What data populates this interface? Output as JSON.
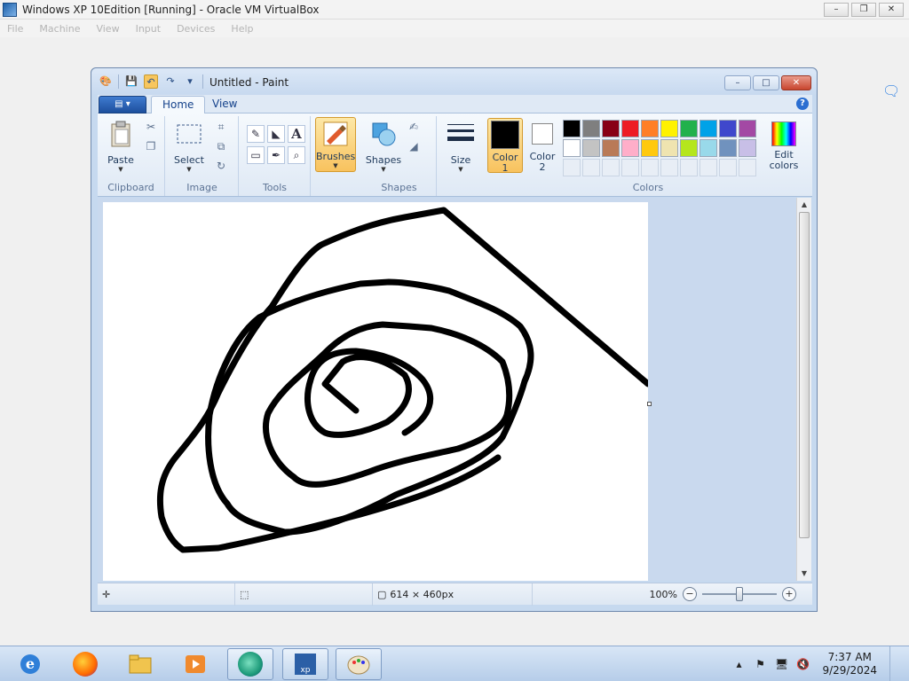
{
  "host": {
    "title": "Windows XP 10Edition [Running] - Oracle VM VirtualBox",
    "menu": [
      "File",
      "Machine",
      "View",
      "Input",
      "Devices",
      "Help"
    ],
    "win_buttons": [
      "–",
      "❐",
      "✕"
    ]
  },
  "paint": {
    "title": "Untitled - Paint",
    "tabs": {
      "file": "▤ ▾",
      "home": "Home",
      "view": "View"
    },
    "help": "?",
    "groups": {
      "clipboard": {
        "label": "Clipboard",
        "paste": "Paste"
      },
      "image": {
        "label": "Image",
        "select": "Select"
      },
      "tools": {
        "label": "Tools",
        "text": "A"
      },
      "brushes": {
        "label": "Brushes"
      },
      "shapes": {
        "label": "Shapes",
        "shapes": "Shapes"
      },
      "size": {
        "label": "Size"
      },
      "colors": {
        "label": "Colors",
        "color1": "Color\n1",
        "color1_a": "Color",
        "color1_b": "1",
        "color2_a": "Color",
        "color2_b": "2",
        "edit_a": "Edit",
        "edit_b": "colors",
        "color1_value": "#000000",
        "color2_value": "#ffffff",
        "palette_row1": [
          "#000000",
          "#7f7f7f",
          "#880015",
          "#ed1c24",
          "#ff7f27",
          "#fff200",
          "#22b14c",
          "#00a2e8",
          "#3f48cc",
          "#a349a4"
        ],
        "palette_row2": [
          "#ffffff",
          "#c3c3c3",
          "#b97a57",
          "#ffaec9",
          "#ffc90e",
          "#efe4b0",
          "#b5e61d",
          "#99d9ea",
          "#7092be",
          "#c8bfe7"
        ]
      }
    },
    "status": {
      "dimensions": "614 × 460px",
      "zoom": "100%",
      "zoom_level_fraction": 0.5
    }
  },
  "taskbar": {
    "apps": [
      "internet-explorer",
      "firefox",
      "file-explorer",
      "media-player",
      "vm-app",
      "xp-app",
      "paint"
    ],
    "clock_time": "7:37 AM",
    "clock_date": "9/29/2024"
  }
}
